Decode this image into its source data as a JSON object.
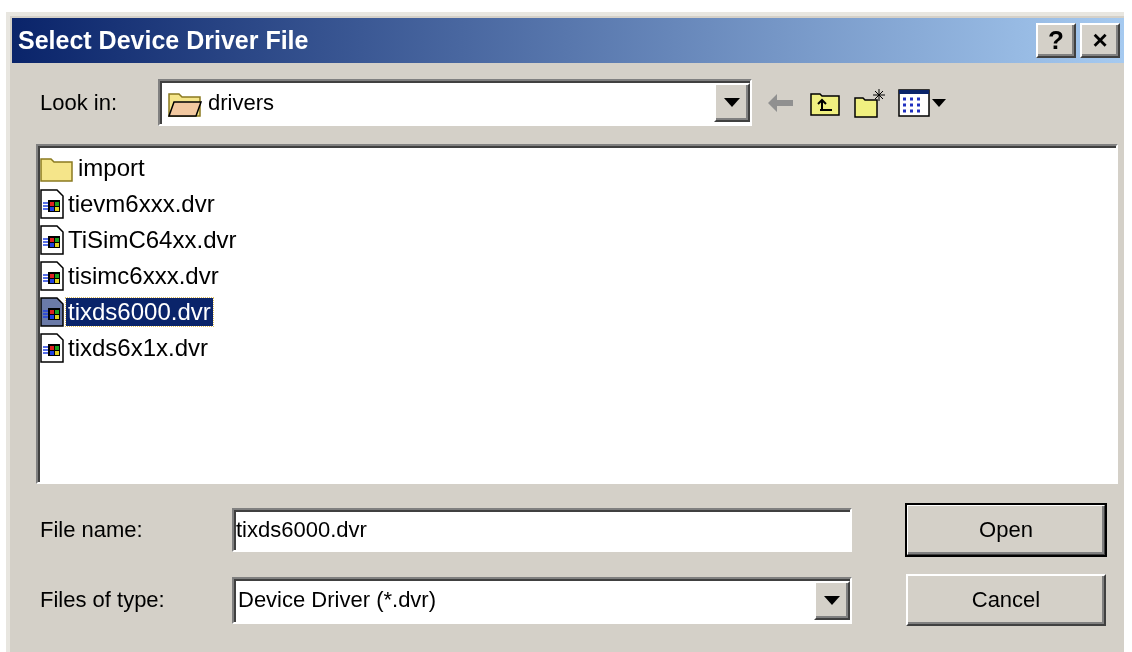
{
  "window": {
    "title": "Select Device Driver File",
    "help_button": "?",
    "close_button": "×"
  },
  "look_in": {
    "label": "Look in:",
    "value": "drivers"
  },
  "files": [
    {
      "name": "import",
      "kind": "folder",
      "selected": false
    },
    {
      "name": "tievm6xxx.dvr",
      "kind": "driver",
      "selected": false
    },
    {
      "name": "TiSimC64xx.dvr",
      "kind": "driver",
      "selected": false
    },
    {
      "name": "tisimc6xxx.dvr",
      "kind": "driver",
      "selected": false
    },
    {
      "name": "tixds6000.dvr",
      "kind": "driver",
      "selected": true
    },
    {
      "name": "tixds6x1x.dvr",
      "kind": "driver",
      "selected": false
    }
  ],
  "file_name": {
    "label": "File name:",
    "value": "tixds6000.dvr"
  },
  "file_type": {
    "label": "Files of type:",
    "value": "Device Driver (*.dvr)"
  },
  "buttons": [
    {
      "label": "Open",
      "default": true
    },
    {
      "label": "Cancel",
      "default": false
    }
  ]
}
